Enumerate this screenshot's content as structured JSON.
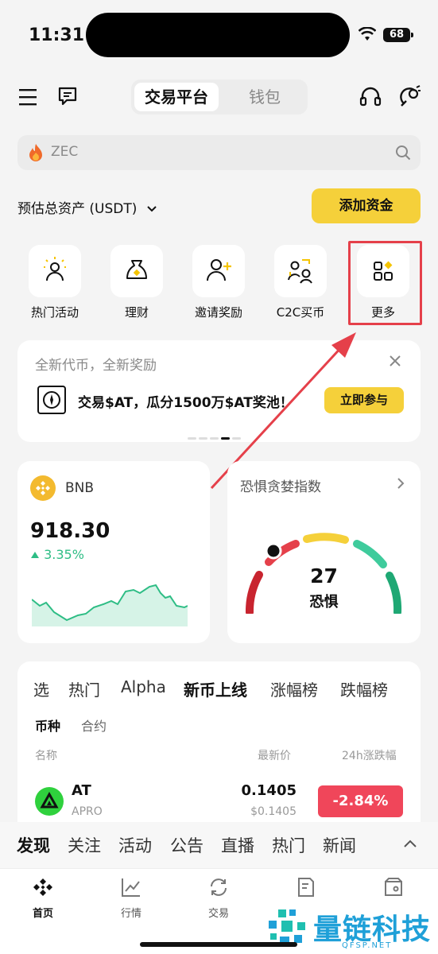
{
  "status": {
    "time": "11:31",
    "battery": "68"
  },
  "header": {
    "tab_exchange": "交易平台",
    "tab_wallet": "钱包"
  },
  "search": {
    "placeholder": "ZEC"
  },
  "assets": {
    "label": "预估总资产 (USDT)",
    "add_funds": "添加资金"
  },
  "quick_actions": [
    {
      "label": "热门活动",
      "icon": "lightbulb-person-icon"
    },
    {
      "label": "理财",
      "icon": "money-bag-icon"
    },
    {
      "label": "邀请奖励",
      "icon": "add-user-icon"
    },
    {
      "label": "C2C买币",
      "icon": "users-exchange-icon"
    },
    {
      "label": "更多",
      "icon": "grid-more-icon"
    }
  ],
  "promo": {
    "title": "全新代币，全新奖励",
    "text": "交易$AT，瓜分1500万$AT奖池！",
    "button": "立即参与"
  },
  "bnb_card": {
    "symbol": "BNB",
    "price": "918.30",
    "change": "3.35%"
  },
  "fear_card": {
    "title": "恐惧贪婪指数",
    "value": "27",
    "label": "恐惧"
  },
  "market": {
    "tabs": [
      "选",
      "热门",
      "Alpha",
      "新币上线",
      "涨幅榜",
      "跌幅榜"
    ],
    "subtabs": [
      "币种",
      "合约"
    ],
    "col_name": "名称",
    "col_price": "最新价",
    "col_change": "24h涨跌幅",
    "rows": [
      {
        "symbol": "AT",
        "name": "APRO",
        "price": "0.1405",
        "price_usd": "$0.1405",
        "change": "-2.84%"
      }
    ]
  },
  "feed_tabs": [
    "发现",
    "关注",
    "活动",
    "公告",
    "直播",
    "热门",
    "新闻"
  ],
  "nav": [
    {
      "label": "首页"
    },
    {
      "label": "行情"
    },
    {
      "label": "交易"
    },
    {
      "label": ""
    },
    {
      "label": ""
    }
  ],
  "watermark": {
    "text": "量链科技",
    "sub": "QFSP.NET"
  },
  "colors": {
    "accent": "#f5d03a",
    "up": "#2ebd85",
    "down": "#f0465a",
    "highlight": "#e5404a"
  }
}
